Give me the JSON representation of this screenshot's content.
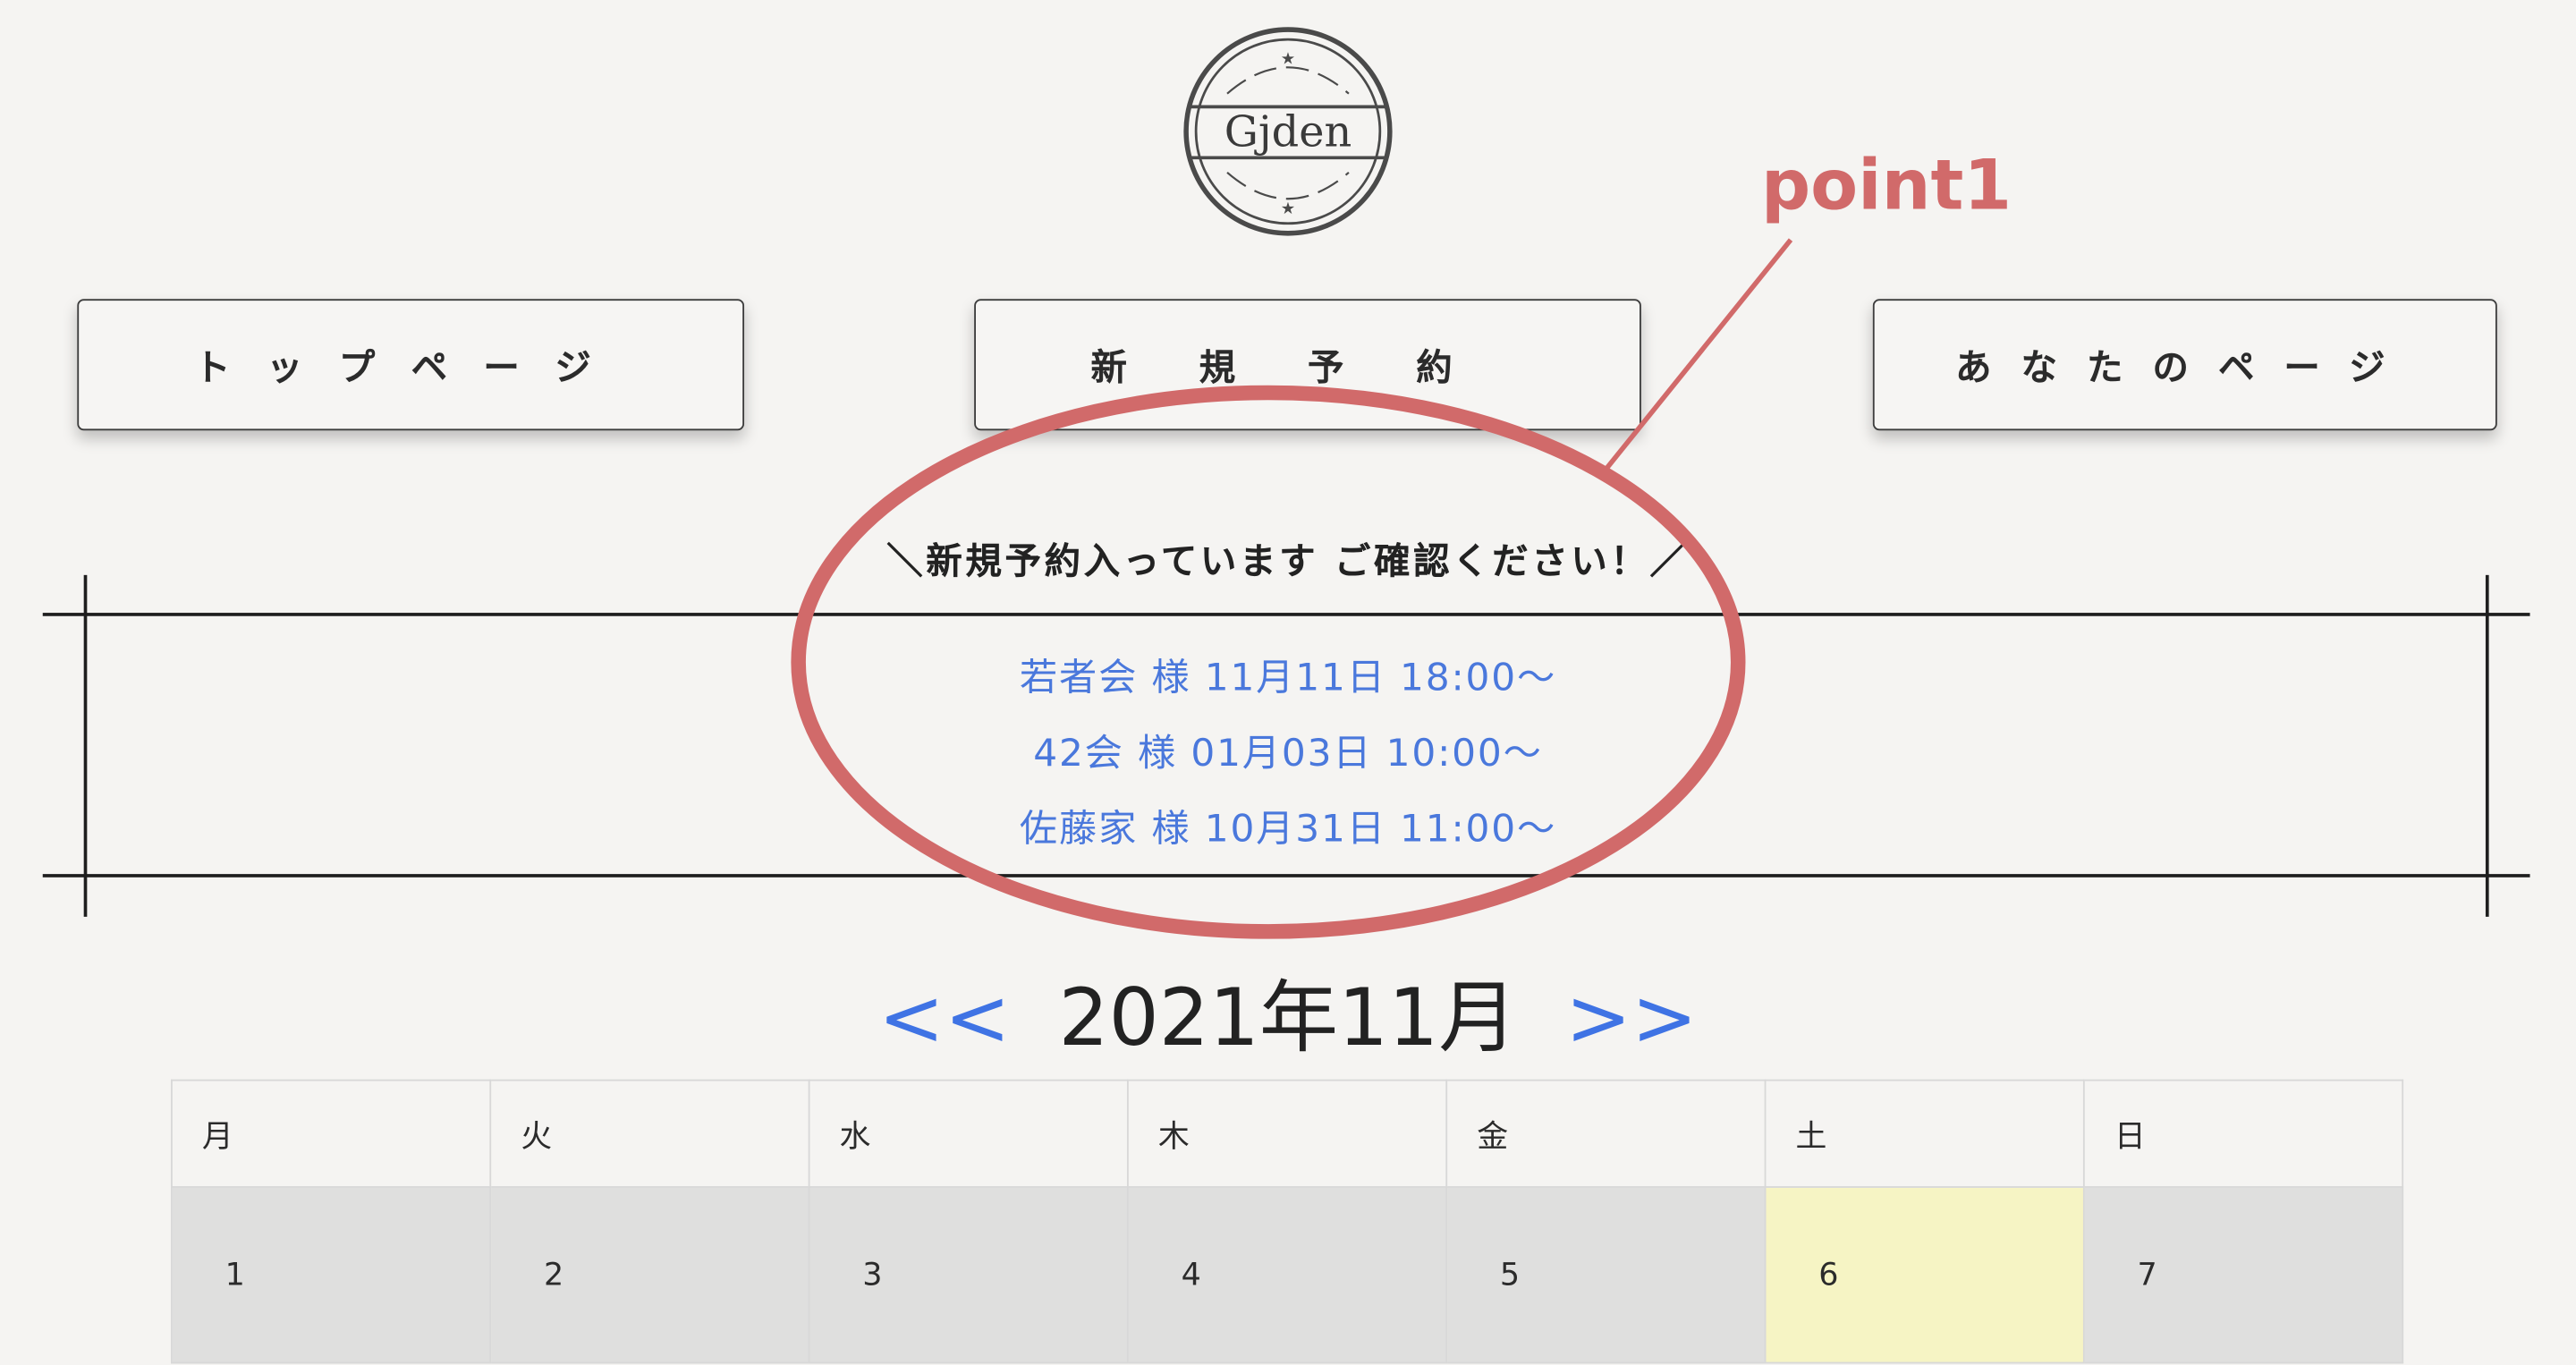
{
  "logo": {
    "text": "Gjden"
  },
  "nav": {
    "top_page": "トップページ",
    "new_reservation": "新規予約",
    "your_page": "あなたのページ"
  },
  "notice": {
    "heading": "＼新規予約入っています ご確認ください！／",
    "reservations": [
      "若者会 様 11月11日 18:00〜",
      "42会 様 01月03日 10:00〜",
      "佐藤家 様 10月31日 11:00〜"
    ]
  },
  "calendar": {
    "prev": "<<",
    "next": ">>",
    "title": "2021年11月",
    "weekdays": [
      "月",
      "火",
      "水",
      "木",
      "金",
      "土",
      "日"
    ],
    "rows": [
      [
        "1",
        "2",
        "3",
        "4",
        "5",
        "6",
        "7"
      ]
    ],
    "today": "6"
  },
  "annotation": {
    "label": "point1",
    "color": "#d16a6a"
  }
}
